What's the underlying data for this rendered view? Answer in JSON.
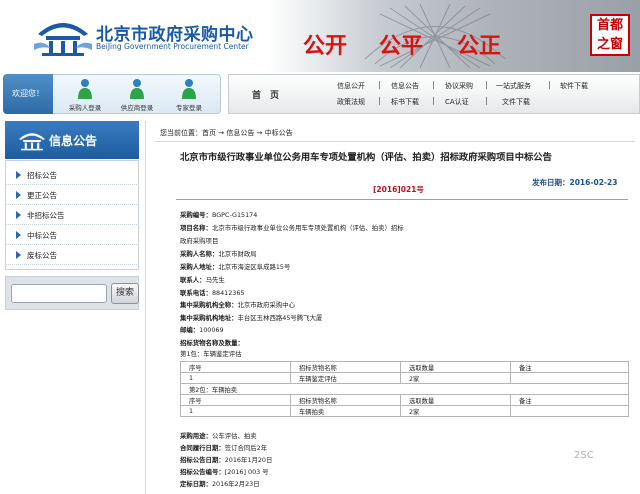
{
  "header": {
    "logo_cn": "北京市政府采购中心",
    "logo_en": "BeiJing Government Procurement Center",
    "slogans": [
      "公开",
      "公平",
      "公正"
    ],
    "capital_badge": [
      "首",
      "都",
      "之",
      "窗"
    ]
  },
  "login": {
    "welcome": "欢迎您！",
    "items": [
      {
        "label": "采购人登录",
        "icon": "user-icon"
      },
      {
        "label": "供应商登录",
        "icon": "user-icon"
      },
      {
        "label": "专家登录",
        "icon": "user-icon"
      }
    ]
  },
  "nav": {
    "home": "首　页",
    "row1": [
      "信息公开",
      "信息公告",
      "协议采购",
      "一站式服务",
      "软件下载"
    ],
    "row2": [
      "政策法规",
      "标书下载",
      "CA认证",
      "文件下载"
    ]
  },
  "sidebar": {
    "title": "信息公告",
    "items": [
      "招标公告",
      "更正公告",
      "非招标公告",
      "中标公告",
      "废标公告"
    ],
    "search_button": "搜索",
    "search_value": ""
  },
  "breadcrumb": "您当前位置：首页 → 信息公告 → 中标公告",
  "article": {
    "title": "北京市市级行政事业单位公务用车专项处置机构（评估、拍卖）招标政府采购项目中标公告",
    "doc_no": "[2016]021号",
    "publish_date": "发布日期：2016-02-23",
    "fields": [
      {
        "label": "采购编号：",
        "value": "BGPC-G15174"
      },
      {
        "label": "项目名称：",
        "value": "北京市市级行政事业单位公务用车专项处置机构（评估、拍卖）招标"
      },
      {
        "label": "",
        "value": "政府采购项目"
      },
      {
        "label": "采购人名称：",
        "value": "北京市财政局"
      },
      {
        "label": "采购人地址：",
        "value": "北京市海淀区阜成路15号"
      },
      {
        "label": "联系人：",
        "value": "马先生"
      },
      {
        "label": "联系电话：",
        "value": "88412365"
      },
      {
        "label": "集中采购机构全称：",
        "value": "北京市政府采购中心"
      },
      {
        "label": "集中采购机构地址：",
        "value": "丰台区玉林西路45号腾飞大厦"
      },
      {
        "label": "邮编：",
        "value": "100069"
      },
      {
        "label": "招标货物名称及数量：",
        "value": ""
      },
      {
        "label": "",
        "value": "第1包：车辆鉴定评估"
      }
    ],
    "table1": {
      "headers": [
        "序号",
        "招标货物名称",
        "选取数量",
        "备注"
      ],
      "rows": [
        [
          "1",
          "车辆鉴定评估",
          "2家",
          ""
        ]
      ]
    },
    "pkg2_label": "第2包：车辆拍卖",
    "table2": {
      "headers": [
        "序号",
        "招标货物名称",
        "选取数量",
        "备注"
      ],
      "rows": [
        [
          "1",
          "车辆拍卖",
          "2家",
          ""
        ]
      ]
    },
    "fields2": [
      {
        "label": "采购用途：",
        "value": "公车评估、拍卖"
      },
      {
        "label": "合同履行日期：",
        "value": "签订合同后2年"
      },
      {
        "label": "招标公告日期：",
        "value": "2016年1月20日"
      },
      {
        "label": "招标公告编号：",
        "value": "[2016] 003 号"
      },
      {
        "label": "定标日期：",
        "value": "2016年2月23日"
      }
    ]
  },
  "watermark": "2SC"
}
